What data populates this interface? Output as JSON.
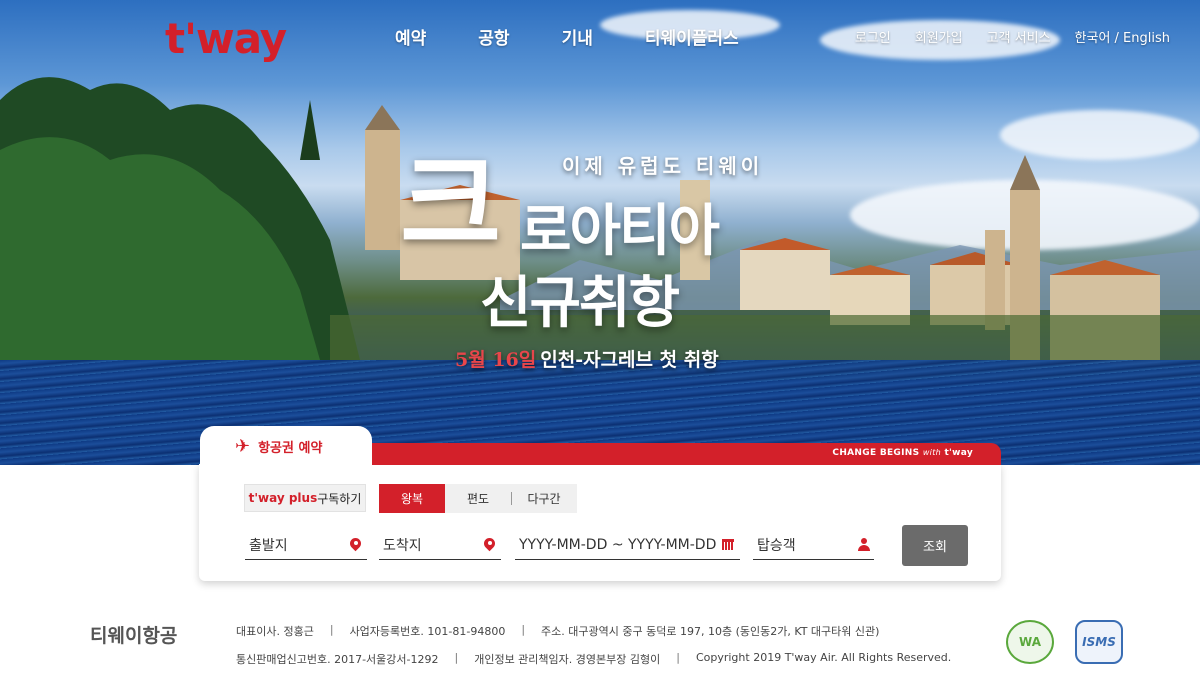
{
  "header": {
    "logo": "t'way",
    "nav": [
      "예약",
      "공항",
      "기내",
      "티웨이플러스"
    ],
    "util": [
      "로그인",
      "회원가입",
      "고객 서비스",
      "한국어 / English"
    ]
  },
  "promo": {
    "subtitle": "이제 유럽도 티웨이",
    "big_letter": "크",
    "line1_rest": "로아티아",
    "line2": "신규취항",
    "date": "5월 16일",
    "route": "인천-자그레브 첫 취항"
  },
  "booking": {
    "tab_label": "항공권 예약",
    "slogan_prefix": "CHANGE BEGINS",
    "slogan_with": "with",
    "slogan_brand": "t'way",
    "plus_brand": "t'way plus",
    "plus_action": "구독하기",
    "trip_types": [
      "왕복",
      "편도",
      "다구간"
    ],
    "active_trip": "왕복",
    "fields": {
      "origin": "출발지",
      "destination": "도착지",
      "dates": "YYYY-MM-DD ~ YYYY-MM-DD",
      "passengers": "탑승객"
    },
    "search_label": "조회"
  },
  "footer": {
    "company": "티웨이항공",
    "row1": [
      "대표이사. 정홍근",
      "사업자등록번호. 101-81-94800",
      "주소. 대구광역시 중구 동덕로 197, 10층 (동인동2가, KT 대구타워 신관)"
    ],
    "row2": [
      "통신판매업신고번호. 2017-서울강서-1292",
      "개인정보 관리책임자. 경영본부장 김형이",
      "Copyright 2019 T'way Air. All Rights Reserved."
    ],
    "badges": [
      "WA",
      "ISMS"
    ]
  },
  "colors": {
    "brand_red": "#d3202a",
    "button_gray": "#6b6b6b"
  }
}
